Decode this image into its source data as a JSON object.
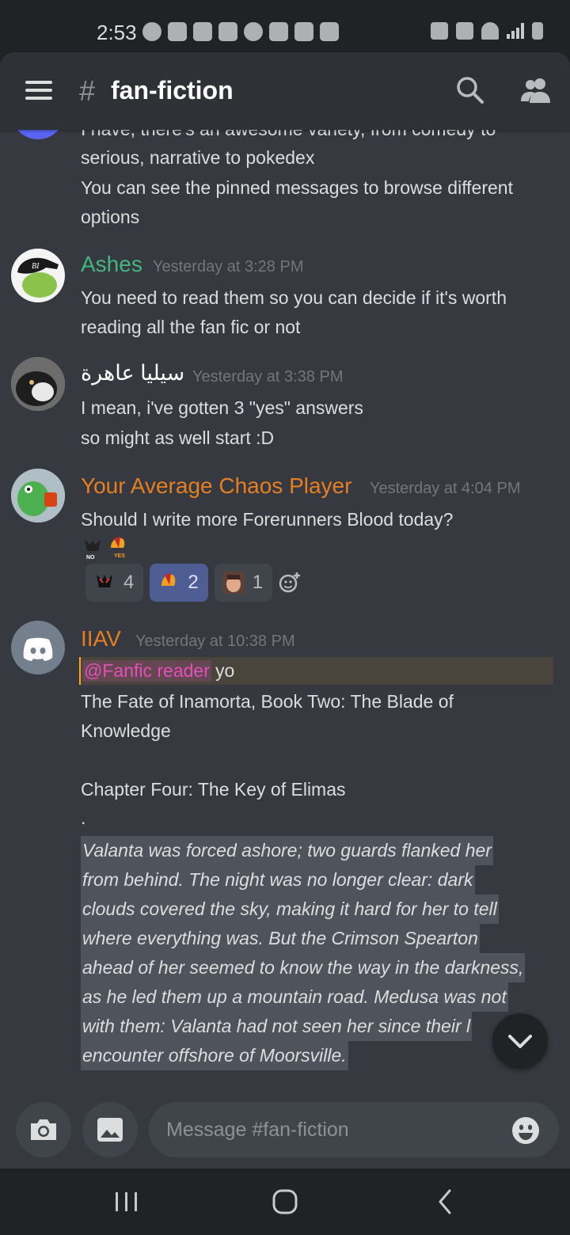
{
  "status_bar": {
    "time": "2:53"
  },
  "header": {
    "channel_hash": "#",
    "channel_name": "fan-fiction"
  },
  "messages": {
    "prev_partial_line": "I have, there's an awesome variety, from comedy to",
    "prev_lines": [
      "serious, narrative to pokedex",
      "You can see the pinned messages to browse different",
      "options"
    ],
    "ashes": {
      "author": "Ashes",
      "author_color": "#43b581",
      "timestamp": "Yesterday at 3:28 PM",
      "lines": [
        "You need to read them so you can decide if it's worth",
        "reading all the fan fic or not"
      ]
    },
    "arabic": {
      "author": "سيليا عاهرة",
      "author_color": "#ffffff",
      "timestamp": "Yesterday at 3:38 PM",
      "lines": [
        "I mean, i've gotten 3 \"yes\" answers",
        "so might as well start :D"
      ]
    },
    "chaos": {
      "author": "Your Average Chaos Player",
      "author_color": "#e67e22",
      "timestamp": "Yesterday at 4:04 PM",
      "lines": [
        "Should I write more Forerunners Blood today?"
      ],
      "inline_emoji_labels": [
        "NO",
        "YES"
      ],
      "reactions": [
        {
          "count": "4",
          "emoji": "no-emoji",
          "reacted_by_me": false
        },
        {
          "count": "2",
          "emoji": "yes-emoji",
          "reacted_by_me": true
        },
        {
          "count": "1",
          "emoji": "face-emoji",
          "reacted_by_me": false
        }
      ]
    },
    "iiav": {
      "author": "IIAV",
      "author_color": "#e67e22",
      "timestamp": "Yesterday at 10:38 PM",
      "mention": "@Fanfic reader",
      "mention_rest": "yo",
      "lines": [
        "The Fate of Inamorta, Book Two: The Blade of",
        "Knowledge",
        "Chapter Four: The Key of Elimas",
        "."
      ],
      "spoiler_lines": [
        "Valanta was forced ashore; two guards flanked her",
        "from behind. The night was no longer clear: dark",
        "clouds covered the sky, making it hard for her to tell",
        "where everything was. But the Crimson Spearton",
        "ahead of her seemed to know the way in the darkness,",
        "as he led them up a mountain road. Medusa was not",
        "with them: Valanta had not seen her since their l",
        "encounter offshore of Moorsville."
      ]
    }
  },
  "composer": {
    "placeholder": "Message #fan-fiction"
  }
}
